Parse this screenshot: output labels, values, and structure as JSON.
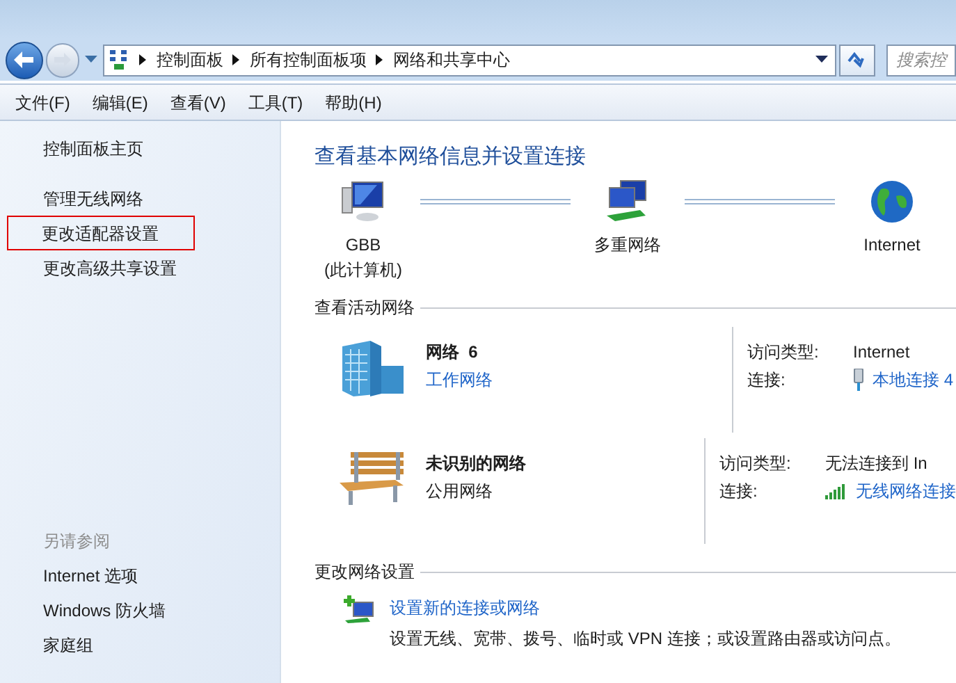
{
  "nav": {
    "path": [
      "控制面板",
      "所有控制面板项",
      "网络和共享中心"
    ],
    "search": {
      "placeholder": "搜索控"
    }
  },
  "menu": [
    "文件(F)",
    "编辑(E)",
    "查看(V)",
    "工具(T)",
    "帮助(H)"
  ],
  "sidebar": {
    "items": [
      {
        "label": "控制面板主页",
        "highlighted": false
      },
      {
        "label": "管理无线网络",
        "highlighted": false
      },
      {
        "label": "更改适配器设置",
        "highlighted": true
      },
      {
        "label": "更改高级共享设置",
        "highlighted": false
      }
    ],
    "see_also": {
      "heading": "另请参阅",
      "items": [
        "Internet 选项",
        "Windows 防火墙",
        "家庭组"
      ]
    }
  },
  "main": {
    "title": "查看基本网络信息并设置连接",
    "map": [
      {
        "kind": "computer",
        "label": "GBB",
        "sublabel": "(此计算机)"
      },
      {
        "kind": "network",
        "label": "多重网络"
      },
      {
        "kind": "internet",
        "label": "Internet"
      }
    ],
    "active_networks": {
      "heading": "查看活动网络",
      "networks": [
        {
          "kind": "work",
          "name": "网络  6",
          "type": "工作网络",
          "link": true,
          "access_label": "访问类型:",
          "access": "Internet",
          "connection_label": "连接:",
          "connection": {
            "kind": "ethernet",
            "label": "本地连接 4"
          }
        },
        {
          "kind": "public",
          "name": "未识别的网络",
          "type": "公用网络",
          "link": false,
          "access_label": "访问类型:",
          "access": "无法连接到 In",
          "connection_label": "连接:",
          "connection": {
            "kind": "wireless",
            "label": "无线网络连接"
          }
        }
      ]
    },
    "change_settings": {
      "heading": "更改网络设置",
      "items": [
        {
          "label": "设置新的连接或网络",
          "description": "设置无线、宽带、拨号、临时或 VPN 连接；或设置路由器或访问点。"
        }
      ]
    }
  }
}
